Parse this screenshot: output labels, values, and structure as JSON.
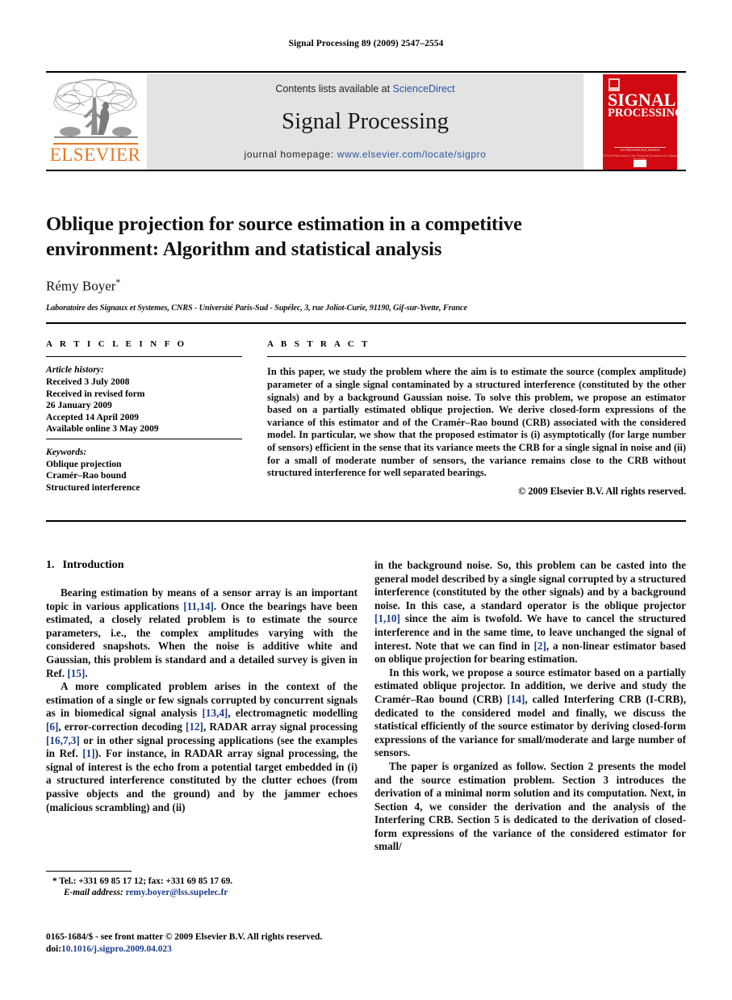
{
  "running_head": "Signal Processing 89 (2009) 2547–2554",
  "banner": {
    "publisher_name": "ELSEVIER",
    "contents_prefix": "Contents lists available at ",
    "contents_link": "ScienceDirect",
    "journal_title": "Signal Processing",
    "homepage_prefix": "journal homepage: ",
    "homepage_url": "www.elsevier.com/locate/sigpro",
    "cover": {
      "line1": "SIGNAL",
      "line2": "PROCESSING",
      "subtitle": "an international journal",
      "subtitle2": "Official Publication of the European Association for Signal Processing",
      "color": "#d10a11"
    }
  },
  "article": {
    "title": "Oblique projection for source estimation in a competitive environment: Algorithm and statistical analysis",
    "author": "Rémy Boyer",
    "author_marker": "*",
    "affiliation": "Laboratoire des Signaux et Systemes, CNRS - Université Paris-Sud - Supélec, 3, rue Joliot-Curie, 91190, Gif-sur-Yvette, France"
  },
  "info": {
    "heading": "A R T I C L E   I N F O",
    "history_label": "Article history:",
    "history": [
      "Received 3 July 2008",
      "Received in revised form",
      "26 January 2009",
      "Accepted 14 April 2009",
      "Available online 3 May 2009"
    ],
    "keywords_label": "Keywords:",
    "keywords": [
      "Oblique projection",
      "Cramér–Rao bound",
      "Structured interference"
    ]
  },
  "abstract": {
    "heading": "A B S T R A C T",
    "text": "In this paper, we study the problem where the aim is to estimate the source (complex amplitude) parameter of a single signal contaminated by a structured interference (constituted by the other signals) and by a background Gaussian noise. To solve this problem, we propose an estimator based on a partially estimated oblique projection. We derive closed-form expressions of the variance of this estimator and of the Cramér–Rao bound (CRB) associated with the considered model. In particular, we show that the proposed estimator is (i) asymptotically (for large number of sensors) efficient in the sense that its variance meets the CRB for a single signal in noise and (ii) for a small of moderate number of sensors, the variance remains close to the CRB without structured interference for well separated bearings.",
    "copyright": "© 2009 Elsevier B.V. All rights reserved."
  },
  "body": {
    "section_number": "1.",
    "section_title": "Introduction",
    "left": {
      "p1": {
        "s1": "Bearing estimation by means of a sensor array is an important topic in various applications ",
        "c1": "[11,14]",
        "s2": ". Once the bearings have been estimated, a closely related problem is to estimate the source parameters, i.e., the complex amplitudes varying with the considered snapshots. When the noise is additive white and Gaussian, this problem is standard and a detailed survey is given in Ref. ",
        "c2": "[15]",
        "s3": "."
      },
      "p2": {
        "s1": "A more complicated problem arises in the context of the estimation of a single or few signals corrupted by concurrent signals as in biomedical signal analysis ",
        "c1": "[13,4]",
        "s2": ", electromagnetic modelling ",
        "c2": "[6]",
        "s3": ", error-correction decoding ",
        "c3": "[12]",
        "s4": ", RADAR array signal processing ",
        "c4": "[16,7,3]",
        "s5": " or in other signal processing applications (see the examples in Ref. ",
        "c5": "[1]",
        "s6": "). For instance, in RADAR array signal processing, the signal of interest is the echo from a potential target embedded in (i) a structured interference constituted by the clutter echoes (from passive objects and the ground) and by the jammer echoes (malicious scrambling) and (ii)"
      }
    },
    "right": {
      "p1": {
        "s1": "in the background noise. So, this problem can be casted into the general model described by a single signal corrupted by a structured interference (constituted by the other signals) and by a background noise. In this case, a standard operator is the oblique projector ",
        "c1": "[1,10]",
        "s2": " since the aim is twofold. We have to cancel the structured interference and in the same time, to leave unchanged the signal of interest. Note that we can find in ",
        "c2": "[2]",
        "s3": ", a non-linear estimator based on oblique projection for bearing estimation."
      },
      "p2": {
        "s1": "In this work, we propose a source estimator based on a partially estimated oblique projector. In addition, we derive and study the Cramér–Rao bound (CRB) ",
        "c1": "[14]",
        "s2": ", called Interfering CRB (I-CRB), dedicated to the considered model and finally, we discuss the statistical efficiently of the source estimator by deriving closed-form expressions of the variance for small/moderate and large number of sensors."
      },
      "p3": {
        "s1": "The paper is organized as follow. Section 2 presents the model and the source estimation problem. Section 3 introduces the derivation of a minimal norm solution and its computation. Next, in Section 4, we consider the derivation and the analysis of the Interfering CRB. Section 5 is dedicated to the derivation of closed-form expressions of the variance of the considered estimator for small/"
      }
    }
  },
  "footnote": {
    "marker": "*",
    "tel": "Tel.: +331 69 85 17 12; fax: +331 69 85 17 69.",
    "email_label": "E-mail address:",
    "email": "remy.boyer@lss.supelec.fr"
  },
  "issn": {
    "line1": "0165-1684/$ - see front matter © 2009 Elsevier B.V. All rights reserved.",
    "doi_label": "doi:",
    "doi": "10.1016/j.sigpro.2009.04.023"
  }
}
